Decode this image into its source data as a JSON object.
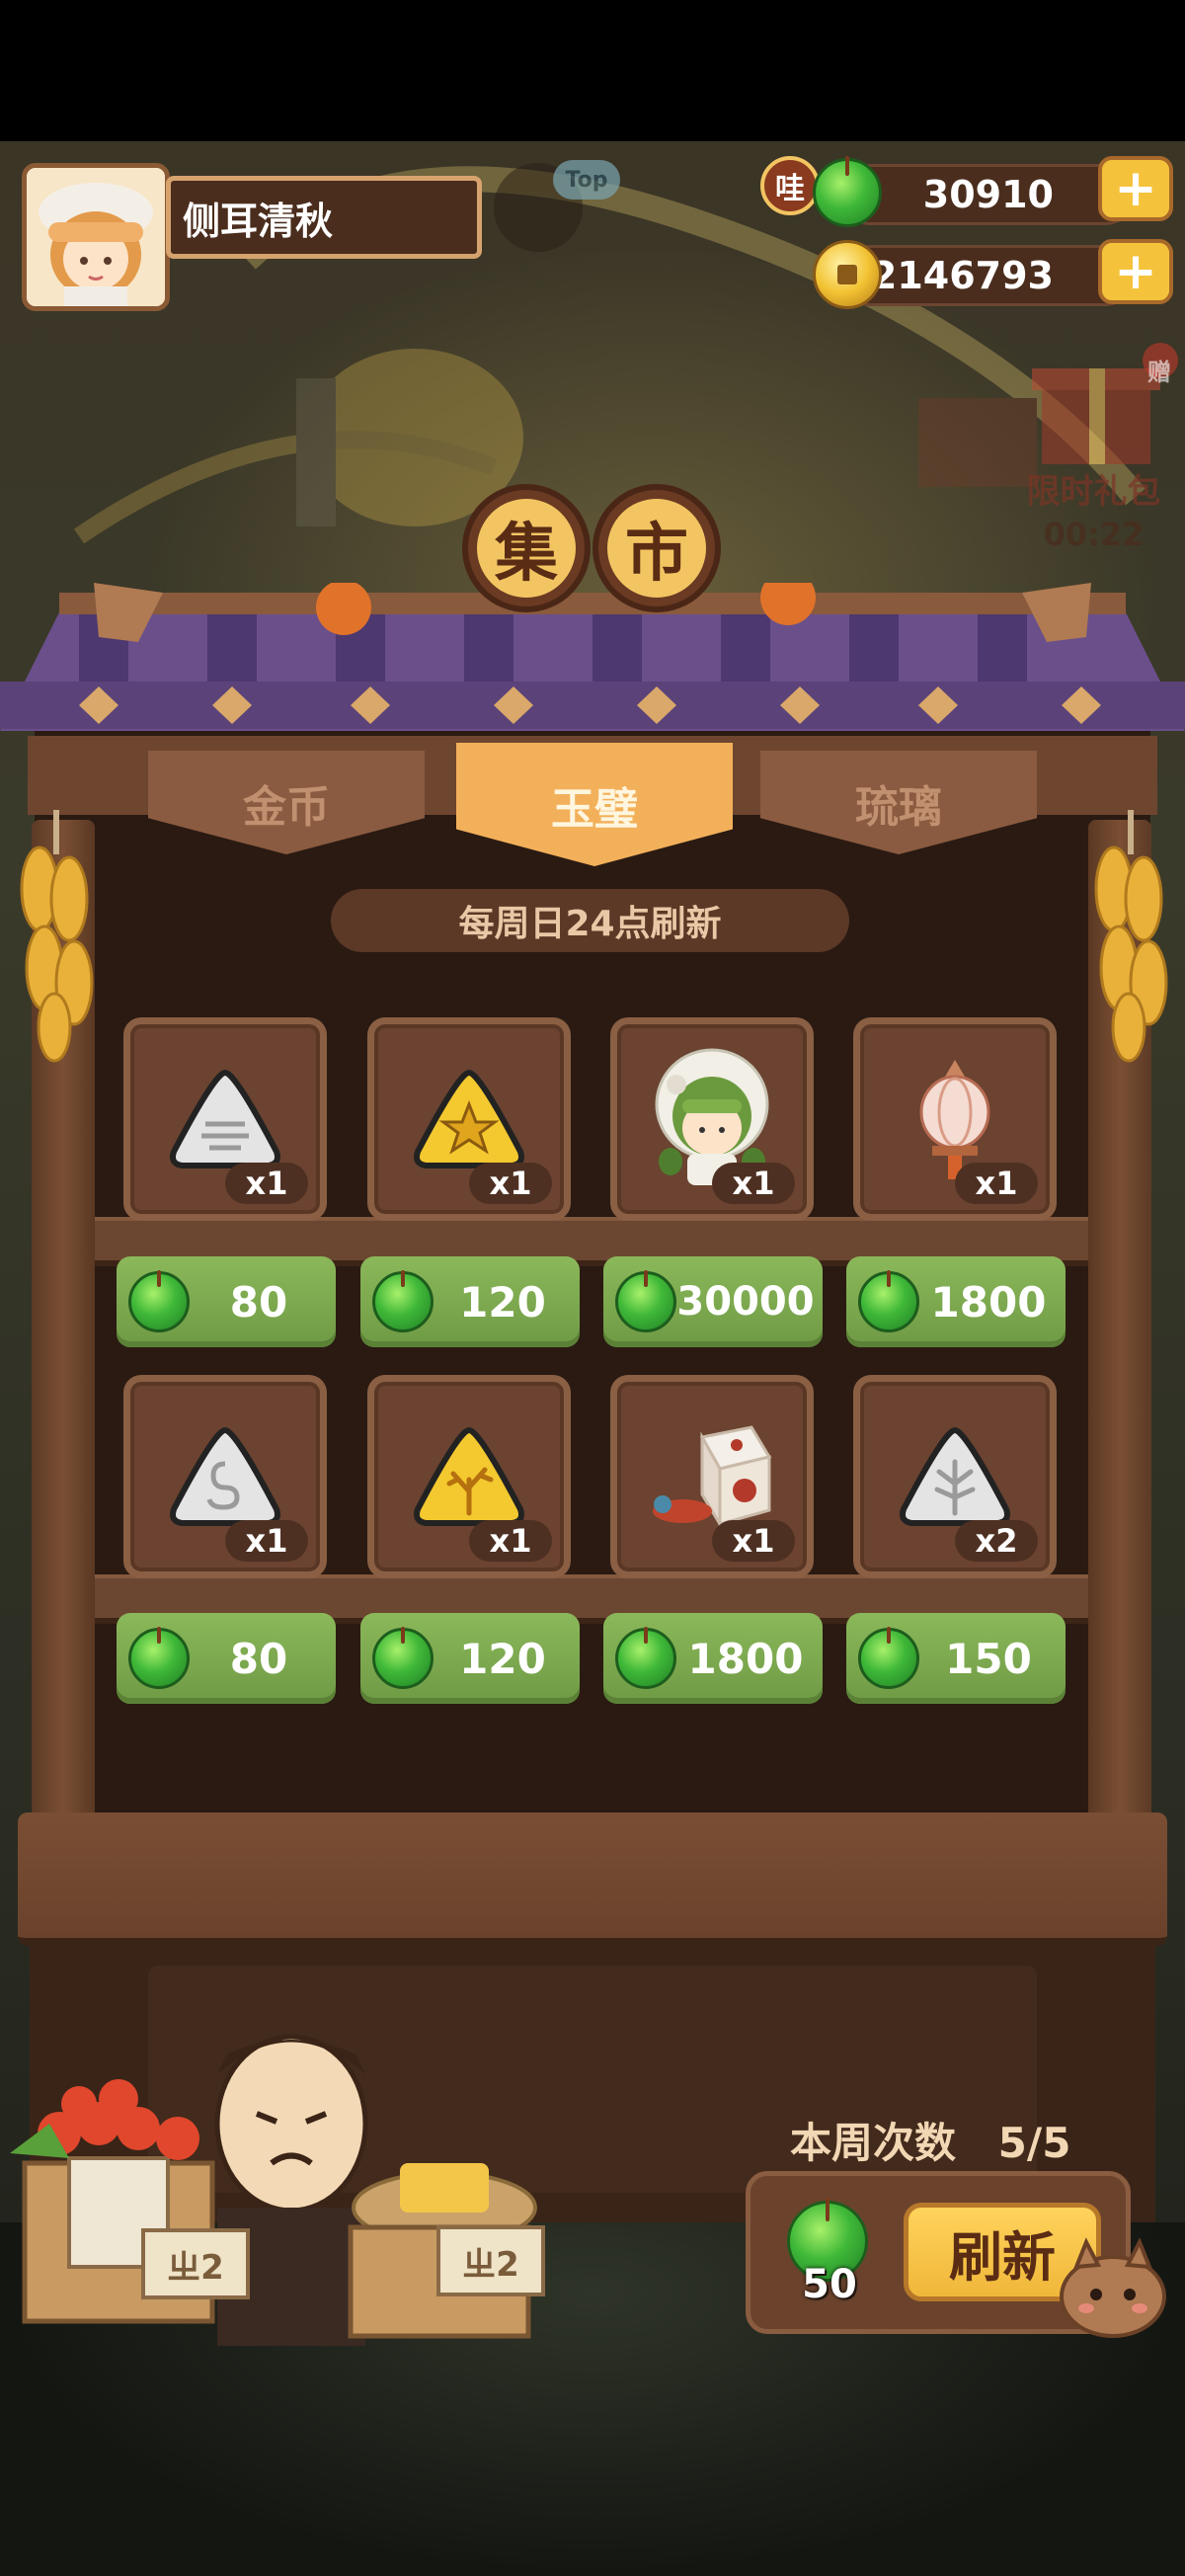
{
  "player": {
    "name": "侧耳清秋",
    "avatar_icon": "girl-chef-avatar"
  },
  "overlay": {
    "top_badge": "Top"
  },
  "currencies": {
    "jade": {
      "label": "哇",
      "value": "30910",
      "icon": "jade-coin-icon"
    },
    "gold": {
      "value": "52146793",
      "icon": "gold-coin-icon"
    },
    "plus": "+"
  },
  "promo": {
    "label": "限时礼包",
    "timer": "00:22",
    "badge": "赠"
  },
  "market_sign": {
    "char1": "集",
    "char2": "市"
  },
  "tabs": [
    {
      "label": "金币",
      "active": false
    },
    {
      "label": "玉璧",
      "active": true
    },
    {
      "label": "琉璃",
      "active": false
    }
  ],
  "refresh_note": "每周日24点刷新",
  "items": [
    {
      "icon": "silver-wave-tile-icon",
      "qty": "x1",
      "price": "80"
    },
    {
      "icon": "gold-star-tile-icon",
      "qty": "x1",
      "price": "120"
    },
    {
      "icon": "green-hair-character-icon",
      "qty": "x1",
      "price": "30000"
    },
    {
      "icon": "lantern-decoration-icon",
      "qty": "x1",
      "price": "1800"
    },
    {
      "icon": "silver-spiral-tile-icon",
      "qty": "x1",
      "price": "80"
    },
    {
      "icon": "gold-coral-tile-icon",
      "qty": "x1",
      "price": "120"
    },
    {
      "icon": "dice-toy-decoration-icon",
      "qty": "x1",
      "price": "1800"
    },
    {
      "icon": "silver-leaf-tile-icon",
      "qty": "x2",
      "price": "150"
    }
  ],
  "weekly": {
    "label": "本周次数",
    "count": "5/5"
  },
  "refresh": {
    "button_label": "刷新",
    "cost": "50"
  },
  "crates": [
    {
      "tag": "ㄓ2"
    },
    {
      "tag": "ㄓ2"
    }
  ],
  "colors": {
    "wood_dark": "#2a1a12",
    "wood": "#6b4330",
    "price_green": "#7aa84e",
    "tab_active": "#f3b05a",
    "gold": "#f5c33b"
  }
}
